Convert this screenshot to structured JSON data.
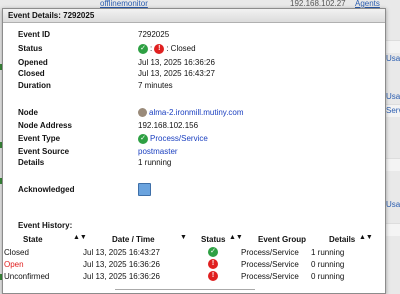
{
  "background": {
    "row_text_1": "offlinemonitor",
    "row_ip": "192.168.102.27",
    "row_agents": "Agents",
    "edge_labels": [
      "Usage",
      "Usage",
      "Servic",
      "Usage"
    ]
  },
  "modal": {
    "title": "Event Details: 7292025",
    "fields": {
      "event_id_label": "Event ID",
      "event_id": "7292025",
      "status_label": "Status",
      "status_sep": ":",
      "status_text": ": Closed",
      "opened_label": "Opened",
      "opened": "Jul 13, 2025 16:36:26",
      "closed_label": "Closed",
      "closed": "Jul 13, 2025 16:43:27",
      "duration_label": "Duration",
      "duration": "7 minutes",
      "node_label": "Node",
      "node": "alma-2.ironmill.mutiny.com",
      "node_address_label": "Node Address",
      "node_address": "192.168.102.156",
      "event_type_label": "Event Type",
      "event_type": "Process/Service",
      "event_source_label": "Event Source",
      "event_source": "postmaster",
      "details_label": "Details",
      "details": "1 running",
      "acknowledged_label": "Acknowledged"
    },
    "history": {
      "title": "Event History:",
      "columns": [
        "State",
        "Date / Time",
        "Status",
        "Event Group",
        "Details"
      ],
      "rows": [
        {
          "state": "Closed",
          "datetime": "Jul 13, 2025 16:43:27",
          "status": "ok",
          "group": "Process/Service",
          "details": "1 running"
        },
        {
          "state": "Open",
          "datetime": "Jul 13, 2025 16:36:26",
          "status": "err",
          "group": "Process/Service",
          "details": "0 running"
        },
        {
          "state": "Unconfirmed",
          "datetime": "Jul 13, 2025 16:36:26",
          "status": "err",
          "group": "Process/Service",
          "details": "0 running"
        }
      ]
    }
  },
  "colors": {
    "ok": "#2ea043",
    "error": "#e02020",
    "link": "#1a3fc0",
    "checkbox": "#6aa3de"
  }
}
